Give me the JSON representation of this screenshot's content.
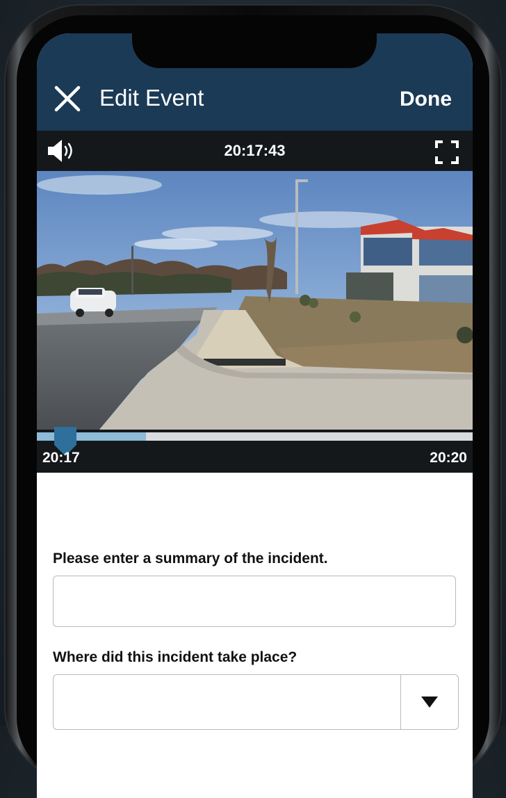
{
  "header": {
    "title": "Edit Event",
    "done_label": "Done",
    "background": "#1b3a55"
  },
  "video": {
    "current_time": "20:17:43",
    "volume_icon": "volume-icon",
    "fullscreen_icon": "fullscreen-icon"
  },
  "scrubber": {
    "start_label": "20:17",
    "end_label": "20:20",
    "buffered_fraction": 0.25,
    "progress_fraction": 0.05,
    "accent": "#2e6f9c"
  },
  "form": {
    "summary_question": "Please enter a summary of the incident.",
    "summary_value": "",
    "location_question": "Where did this incident take place?",
    "location_value": ""
  }
}
